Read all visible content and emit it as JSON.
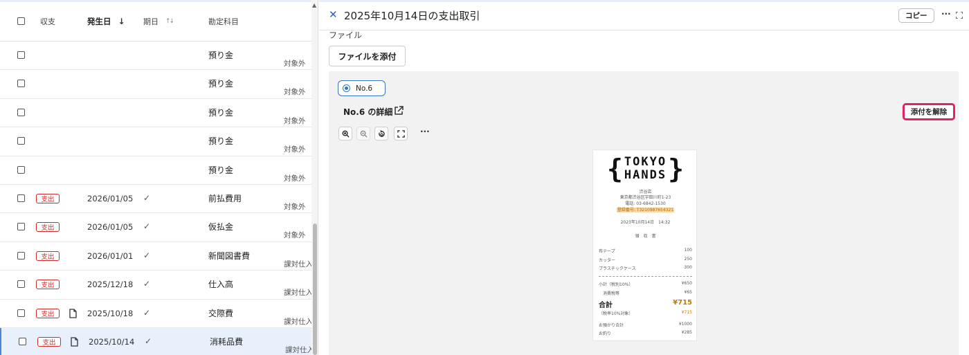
{
  "table": {
    "headers": {
      "kind": "収支",
      "date": "発生日",
      "date_sort_icon": "arrow-down-icon",
      "due": "期日",
      "due_sort_icon": "sort-icon",
      "account": "勘定科目"
    },
    "rows": [
      {
        "badge": "",
        "doc": false,
        "date": "",
        "due_check": false,
        "account": "預り金",
        "tax": "対象外"
      },
      {
        "badge": "",
        "doc": false,
        "date": "",
        "due_check": false,
        "account": "預り金",
        "tax": "対象外"
      },
      {
        "badge": "",
        "doc": false,
        "date": "",
        "due_check": false,
        "account": "預り金",
        "tax": "対象外"
      },
      {
        "badge": "",
        "doc": false,
        "date": "",
        "due_check": false,
        "account": "預り金",
        "tax": "対象外"
      },
      {
        "badge": "",
        "doc": false,
        "date": "",
        "due_check": false,
        "account": "預り金",
        "tax": "対象外"
      },
      {
        "badge": "支出",
        "doc": false,
        "date": "2026/01/05",
        "due_check": true,
        "account": "前払費用",
        "tax": "対象外"
      },
      {
        "badge": "支出",
        "doc": false,
        "date": "2026/01/05",
        "due_check": true,
        "account": "仮払金",
        "tax": "対象外"
      },
      {
        "badge": "支出",
        "doc": false,
        "date": "2026/01/01",
        "due_check": true,
        "account": "新聞図書費",
        "tax": "課対仕入"
      },
      {
        "badge": "支出",
        "doc": false,
        "date": "2025/12/18",
        "due_check": true,
        "account": "仕入高",
        "tax": "課対仕入"
      },
      {
        "badge": "支出",
        "doc": true,
        "date": "2025/10/18",
        "due_check": true,
        "account": "交際費",
        "tax": "課対仕入"
      },
      {
        "badge": "支出",
        "doc": true,
        "date": "2025/10/14",
        "due_check": true,
        "account": "消耗品費",
        "tax": "課対仕入",
        "selected": true
      }
    ]
  },
  "panel": {
    "title": "2025年10月14日の支出取引",
    "copy_label": "コピー",
    "file_label": "ファイル",
    "attach_label": "ファイルを添付",
    "radio_label": "No.6",
    "detail_title": "No.6 の詳細",
    "detach_label": "添付を解除"
  },
  "receipt": {
    "brand_line1": "TOKYO",
    "brand_line2": "HANDS",
    "store": "渋谷店",
    "address": "東京都渋谷区宇田川町1-23",
    "phone": "電話: 03-6842-1530",
    "registration": "登録番号: T3210987654321",
    "datetime": "2023年10月14日　14:32",
    "doc_type": "領　収　書",
    "items": [
      {
        "name": "布テープ",
        "price": "100"
      },
      {
        "name": "カッター",
        "price": "250"
      },
      {
        "name": "プラスチックケース",
        "price": "300"
      }
    ],
    "subtotal_label": "小計（税別10%）",
    "subtotal": "¥650",
    "tax_label": "消費税等",
    "tax": "¥65",
    "total_label": "合計",
    "total": "¥715",
    "tax_target_label": "（税率10%対象）",
    "tax_target": "¥715",
    "received_label": "お預かり合計",
    "received": "¥1000",
    "change_label": "お釣り",
    "change": "¥285"
  },
  "colors": {
    "accent": "#3a72c4",
    "badge_red": "#d02b2b",
    "detach_border": "#e0245e",
    "receipt_orange": "#c47a00"
  }
}
